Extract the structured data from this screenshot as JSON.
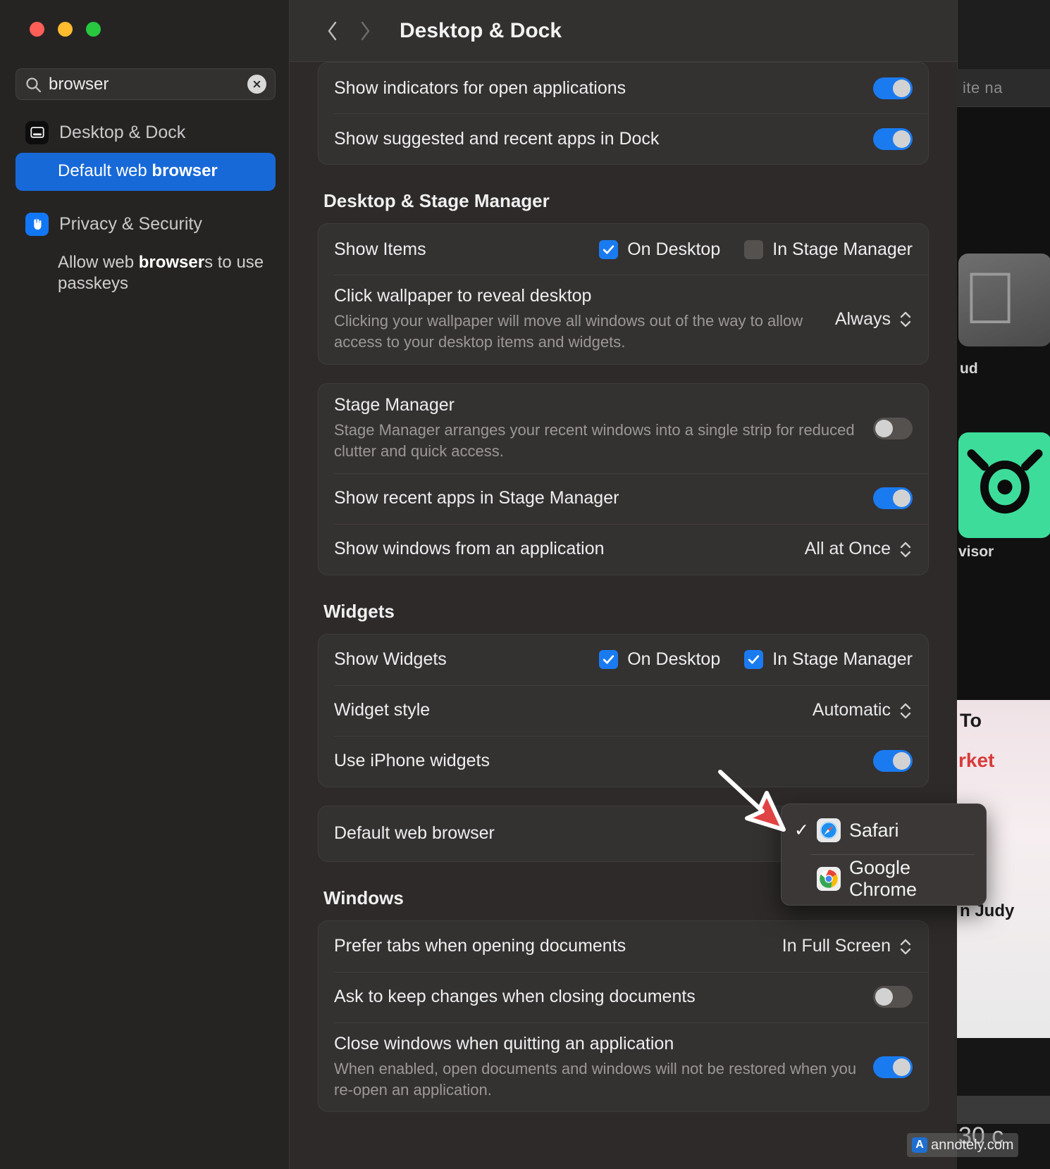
{
  "window": {
    "title": "Desktop & Dock",
    "back_label": "Back",
    "forward_label": "Forward",
    "traffic": {
      "close": "close",
      "minimize": "minimize",
      "zoom": "zoom"
    }
  },
  "search": {
    "value": "browser",
    "placeholder": "Search",
    "clear_label": "Clear search"
  },
  "sidebar": {
    "groups": [
      {
        "icon": "desktop-dock-icon",
        "title": "Desktop & Dock",
        "results": [
          {
            "prefix": "Default web ",
            "match": "browser",
            "suffix": "",
            "selected": true
          }
        ]
      },
      {
        "icon": "privacy-security-icon",
        "title": "Privacy & Security",
        "results": [
          {
            "prefix": "Allow web ",
            "match": "browser",
            "suffix": "s to use passkeys",
            "selected": false
          }
        ]
      }
    ]
  },
  "main": {
    "dock_rows": [
      {
        "label": "Show indicators for open applications",
        "control": "toggle",
        "state": "on"
      },
      {
        "label": "Show suggested and recent apps in Dock",
        "control": "toggle",
        "state": "on"
      }
    ],
    "sections": [
      {
        "heading": "Desktop & Stage Manager",
        "cards": [
          {
            "rows": [
              {
                "type": "checkboxes",
                "label": "Show Items",
                "checkboxes": [
                  {
                    "label": "On Desktop",
                    "state": "on"
                  },
                  {
                    "label": "In Stage Manager",
                    "state": "off"
                  }
                ]
              },
              {
                "type": "popup",
                "title": "Click wallpaper to reveal desktop",
                "desc": "Clicking your wallpaper will move all windows out of the way to allow access to your desktop items and widgets.",
                "value": "Always"
              }
            ]
          },
          {
            "rows": [
              {
                "type": "toggle",
                "title": "Stage Manager",
                "desc": "Stage Manager arranges your recent windows into a single strip for reduced clutter and quick access.",
                "state": "off"
              },
              {
                "type": "toggle",
                "title": "Show recent apps in Stage Manager",
                "state": "on"
              },
              {
                "type": "popup",
                "title": "Show windows from an application",
                "value": "All at Once"
              }
            ]
          }
        ]
      },
      {
        "heading": "Widgets",
        "cards": [
          {
            "rows": [
              {
                "type": "checkboxes",
                "label": "Show Widgets",
                "checkboxes": [
                  {
                    "label": "On Desktop",
                    "state": "on"
                  },
                  {
                    "label": "In Stage Manager",
                    "state": "on"
                  }
                ]
              },
              {
                "type": "popup",
                "title": "Widget style",
                "value": "Automatic"
              },
              {
                "type": "toggle",
                "title": "Use iPhone widgets",
                "state": "on"
              }
            ]
          },
          {
            "rows": [
              {
                "type": "plain",
                "title": "Default web browser",
                "value": ""
              }
            ]
          }
        ]
      },
      {
        "heading": "Windows",
        "cards": [
          {
            "rows": [
              {
                "type": "popup",
                "title": "Prefer tabs when opening documents",
                "value": "In Full Screen"
              },
              {
                "type": "toggle",
                "title": "Ask to keep changes when closing documents",
                "state": "off"
              },
              {
                "type": "toggle",
                "title": "Close windows when quitting an application",
                "desc": "When enabled, open documents and windows will not be restored when you re-open an application.",
                "state": "on"
              }
            ]
          }
        ]
      }
    ]
  },
  "dropdown": {
    "items": [
      {
        "label": "Safari",
        "icon": "safari-icon",
        "checked": true
      },
      {
        "label": "Google Chrome",
        "icon": "chrome-icon",
        "checked": false
      }
    ],
    "check_glyph": "✓"
  },
  "annotation": {
    "arrow": "red-arrow-pointing-to-dropdown"
  },
  "background": {
    "tab_text": "ite na",
    "tile_labels": [
      "ud",
      "visor"
    ],
    "card_line1": "To",
    "card_line2": "rket",
    "card_line3": "n Judy",
    "corner_text": "30 c"
  },
  "watermark": {
    "badge": "A",
    "text": "annotely.com"
  },
  "colors": {
    "accent": "#1a7bf0",
    "selection": "#1769d8",
    "arrow": "#e04343",
    "window_bg": "#2d2a29",
    "sidebar_bg": "#262423",
    "card_bg": "#343131"
  }
}
